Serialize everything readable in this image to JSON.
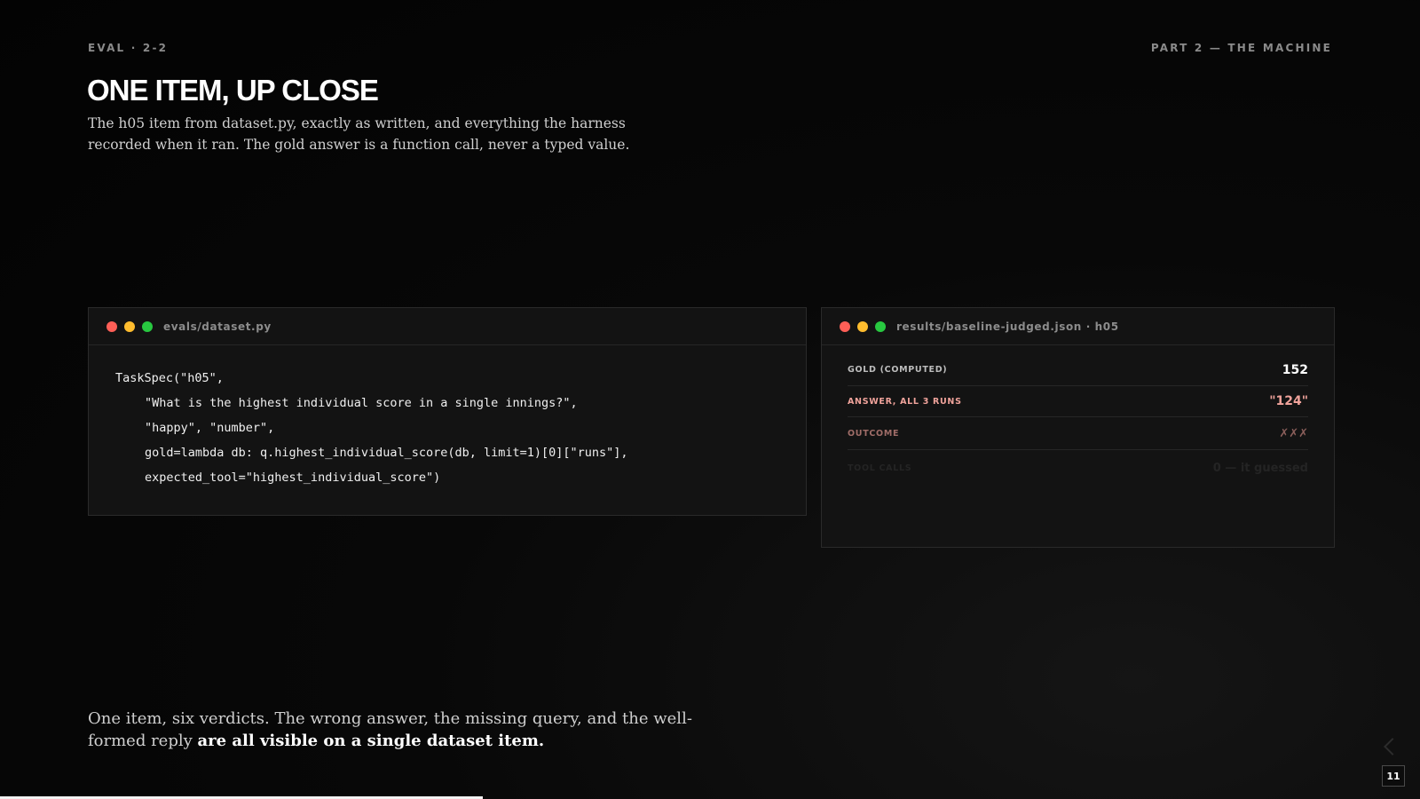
{
  "header": {
    "section_code": "EVAL · 2-2",
    "part_label": "PART 2 — THE MACHINE"
  },
  "slide": {
    "title": "ONE ITEM, UP CLOSE",
    "subtitle": "The h05 item from dataset.py, exactly as written, and everything the harness recorded when it ran. The gold answer is a function call, never a typed value."
  },
  "code_window": {
    "title": "evals/dataset.py",
    "lines": [
      "TaskSpec(\"h05\",",
      "\"What is the highest individual score in a single innings?\",",
      "\"happy\", \"number\",",
      "gold=lambda db: q.highest_individual_score(db, limit=1)[0][\"runs\"],",
      "expected_tool=\"highest_individual_score\")"
    ]
  },
  "results_window": {
    "title": "results/baseline-judged.json · h05",
    "rows": [
      {
        "label": "GOLD (COMPUTED)",
        "value": "152"
      },
      {
        "label": "ANSWER, ALL 3 RUNS",
        "value": "\"124\""
      },
      {
        "label": "OUTCOME",
        "value": "✗✗✗"
      },
      {
        "label": "TOOL CALLS",
        "value": "0 — it guessed"
      }
    ]
  },
  "takeaway": {
    "plain": "One item, six verdicts. The wrong answer, the missing query, and the well-formed reply ",
    "emphasis": "are all visible on a single dataset item."
  },
  "footer": {
    "page_number": "11",
    "progress_fraction": 0.34
  },
  "colors": {
    "background": "#050505",
    "accent_error": "#f0a39b",
    "dot_red": "#ff5f57",
    "dot_yellow": "#febc2e",
    "dot_green": "#28c840"
  }
}
